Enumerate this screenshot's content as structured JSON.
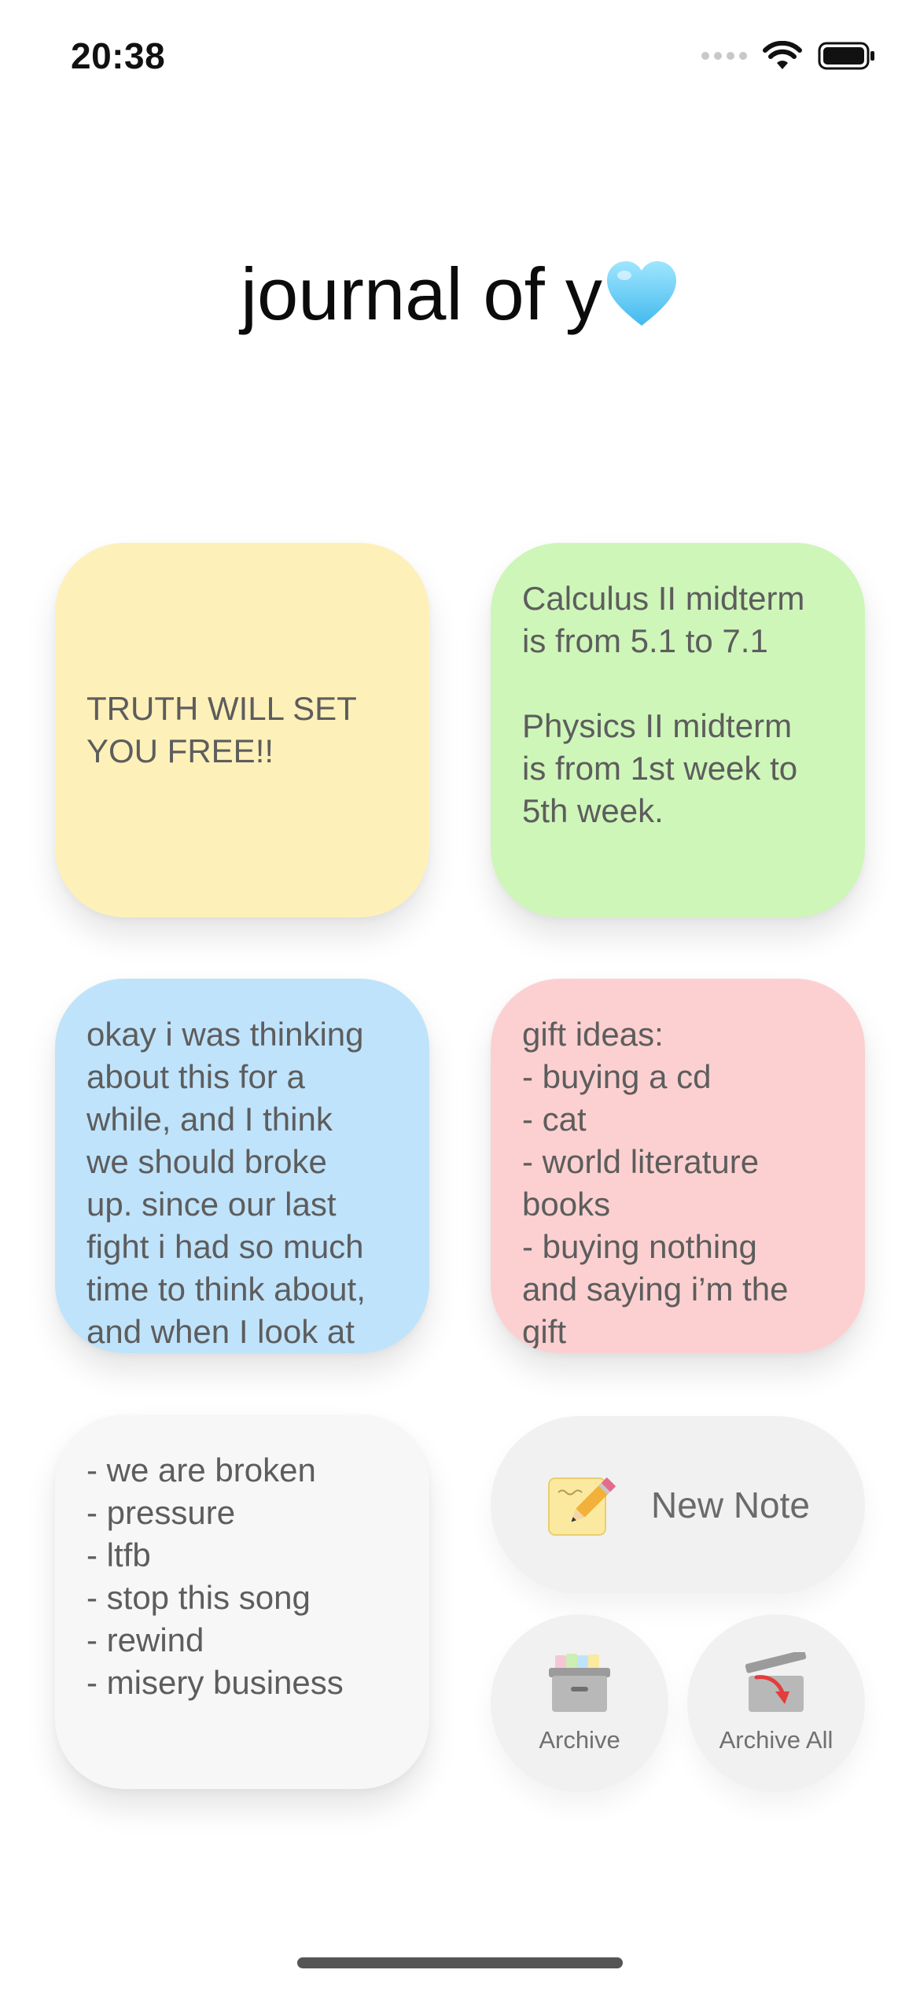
{
  "status_bar": {
    "time": "20:38"
  },
  "app": {
    "title": "journal of y"
  },
  "notes": [
    {
      "text": "TRUTH WILL SET\nYOU FREE!!",
      "color": "#fdf1b9"
    },
    {
      "text": "Calculus II midterm\nis from 5.1 to 7.1\n\nPhysics II midterm\nis from 1st week to\n5th week.",
      "color": "#cef6b9"
    },
    {
      "text": "okay i was thinking\nabout this for a\nwhile, and I think\nwe should broke\nup. since our last\nfight i had so much\ntime to think about,\nand when I look at",
      "color": "#bfe3fb"
    },
    {
      "text": "gift ideas:\n- buying a cd\n- cat\n- world literature\nbooks\n- buying nothing\nand saying i’m the\ngift",
      "color": "#fcd0d1"
    },
    {
      "text": "- we are broken\n- pressure\n- ltfb\n- stop this song\n- rewind\n- misery business",
      "color": "#f7f7f7"
    }
  ],
  "actions": {
    "new_note_label": "New Note",
    "archive_label": "Archive",
    "archive_all_label": "Archive All"
  },
  "icons": {
    "title_emoji": "light-blue-heart-icon",
    "new_note": "memo-pencil-icon",
    "archive": "archive-box-icon",
    "archive_all": "archive-all-icon"
  }
}
